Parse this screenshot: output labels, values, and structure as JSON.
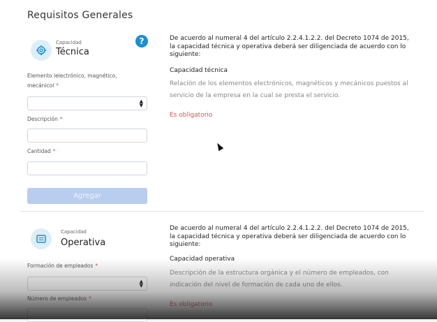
{
  "page": {
    "title": "Requisitos Generales"
  },
  "tecnica": {
    "small_label": "Capacidad",
    "big_label": "Técnica",
    "fields": {
      "elemento_label": "Elemento lelectrónico, magnético, mecánicol",
      "descripcion_label": "Descripción",
      "cantidad_label": "Cantidad",
      "required_mark": "*"
    },
    "add_button": "Agregar",
    "help_glyph": "?",
    "intro": "De acuerdo al numeral 4 del artículo 2.2.4.1.2.2. del Decreto 1074 de 2015, la capacidad técnica y operativa deberá ser diligenciada de acuerdo con lo siguiente:",
    "subheading": "Capacidad técnica",
    "description": "Relación de los elementos electrónicos, magnéticos y mecánicos puestos al servicio de la empresa en la cual se presta el servicio.",
    "obligatorio": "Es obligatorio"
  },
  "operativa": {
    "small_label": "Capacidad",
    "big_label": "Operativa",
    "fields": {
      "formacion_label": "Formación de empleados",
      "numero_label": "Número de empleados",
      "required_mark": "*"
    },
    "intro": "De acuerdo al numeral 4 del artículo 2.2.4.1.2.2. del Decreto 1074 de 2015, la capacidad técnica y operativa deberá ser diligenciada de acuerdo con lo siguiente:",
    "subheading": "Capacidad operativa",
    "description": "Descripción de la estructura orgánica y el número de empleados, con indicación del nivel de formación de cada uno de ellos.",
    "obligatorio": "Es obligatorio"
  },
  "icons": [
    "gear-icon",
    "help-icon",
    "document-icon",
    "select-arrows-icon",
    "mouse-cursor-icon"
  ],
  "colors": {
    "accent": "#1a8fd6",
    "required": "#d9534f",
    "button_disabled": "#b9cdf0",
    "icon_bg": "#dceff9"
  }
}
